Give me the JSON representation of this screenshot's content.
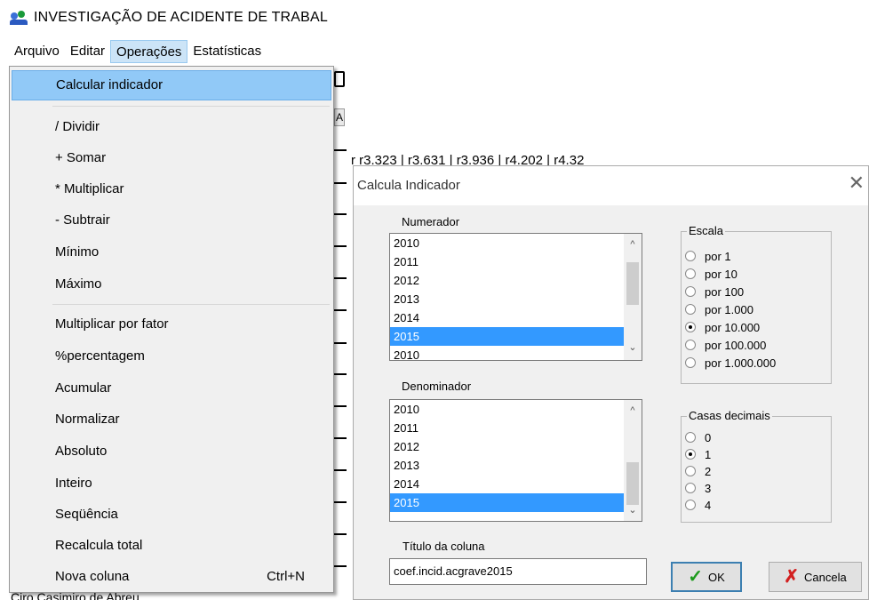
{
  "app": {
    "title": "INVESTIGAÇÃO DE ACIDENTE DE TRABAL"
  },
  "menubar": {
    "items": [
      {
        "label": "Arquivo"
      },
      {
        "label": "Editar"
      },
      {
        "label": "Operações"
      },
      {
        "label": "Estatísticas"
      }
    ]
  },
  "background": {
    "column_header": "A",
    "grid_row": "r      r3.323 |          r3.631 |          r3.936 |          r4.202 |          r4.32",
    "bottom_text": "Ciro Casimiro de Abreu"
  },
  "dropdown": {
    "items": [
      {
        "label": "Calcular indicador",
        "highlighted": true
      },
      {
        "label": "/ Dividir"
      },
      {
        "label": "+ Somar"
      },
      {
        "label": "* Multiplicar"
      },
      {
        "label": "- Subtrair"
      },
      {
        "label": "Mínimo"
      },
      {
        "label": "Máximo"
      },
      {
        "label": "Multiplicar por fator"
      },
      {
        "label": "%percentagem"
      },
      {
        "label": "Acumular"
      },
      {
        "label": "Normalizar"
      },
      {
        "label": "Absoluto"
      },
      {
        "label": "Inteiro"
      },
      {
        "label": "Seqüência"
      },
      {
        "label": "Recalcula total"
      },
      {
        "label": "Nova coluna",
        "shortcut": "Ctrl+N"
      }
    ]
  },
  "dialog": {
    "title": "Calcula Indicador",
    "close_icon": "close-icon",
    "numerador": {
      "label": "Numerador",
      "items": [
        "2010",
        "2011",
        "2012",
        "2013",
        "2014",
        "2015",
        "2010"
      ],
      "selected": "2015"
    },
    "denominador": {
      "label": "Denominador",
      "items": [
        "2010",
        "2011",
        "2012",
        "2013",
        "2014",
        "2015"
      ],
      "selected": "2015"
    },
    "escala": {
      "label": "Escala",
      "options": [
        "por 1",
        "por 10",
        "por 100",
        "por 1.000",
        "por 10.000",
        "por 100.000",
        "por 1.000.000"
      ],
      "selected": "por 10.000"
    },
    "casas_decimais": {
      "label": "Casas decimais",
      "options": [
        "0",
        "1",
        "2",
        "3",
        "4"
      ],
      "selected": "1"
    },
    "titulo_coluna": {
      "label": "Título da coluna",
      "value": "coef.incid.acgrave2015"
    },
    "buttons": {
      "ok": "OK",
      "cancel": "Cancela"
    },
    "colors": {
      "selection": "#3399ff",
      "menu_highlight": "#91c9f7",
      "ok_icon": "#1c9a1c",
      "cancel_icon": "#d21f1f"
    }
  }
}
